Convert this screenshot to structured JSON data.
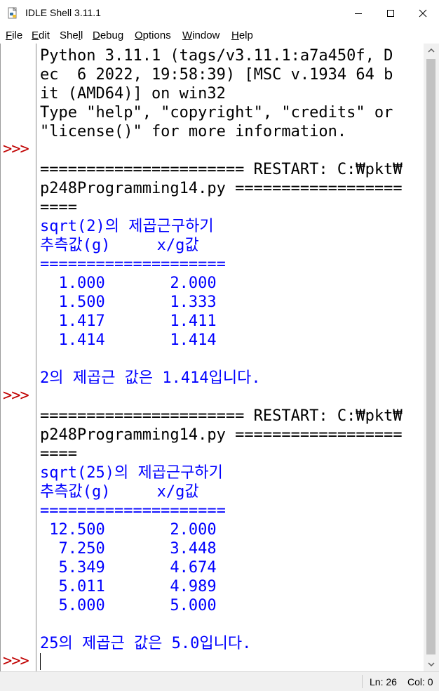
{
  "window": {
    "title": "IDLE Shell 3.11.1",
    "icon": "idle-python-icon"
  },
  "menu": {
    "items": [
      {
        "ul": "F",
        "rest": "ile"
      },
      {
        "ul": "E",
        "rest": "dit"
      },
      {
        "pre": "She",
        "ul": "l",
        "rest": "l"
      },
      {
        "ul": "D",
        "rest": "ebug"
      },
      {
        "ul": "O",
        "rest": "ptions"
      },
      {
        "ul": "W",
        "rest": "indow"
      },
      {
        "ul": "H",
        "rest": "elp"
      }
    ]
  },
  "prompt_symbol": ">>>",
  "shell": {
    "lines": [
      {
        "text": "Python 3.11.1 (tags/v3.11.1:a7a450f, D",
        "color": "black"
      },
      {
        "text": "ec  6 2022, 19:58:39) [MSC v.1934 64 b",
        "color": "black"
      },
      {
        "text": "it (AMD64)] on win32",
        "color": "black"
      },
      {
        "text": "Type \"help\", \"copyright\", \"credits\" or",
        "color": "black"
      },
      {
        "text": "\"license()\" for more information.",
        "color": "black"
      },
      {
        "text": "",
        "color": "black"
      },
      {
        "text": "====================== RESTART: C:₩pkt₩",
        "color": "black"
      },
      {
        "text": "p248Programming14.py ==================",
        "color": "black"
      },
      {
        "text": "====",
        "color": "black"
      },
      {
        "text": "sqrt(2)의 제곱근구하기",
        "color": "blue"
      },
      {
        "text": "추측값(g)     x/g값",
        "color": "blue"
      },
      {
        "text": "====================",
        "color": "blue"
      },
      {
        "text": "  1.000       2.000",
        "color": "blue"
      },
      {
        "text": "  1.500       1.333",
        "color": "blue"
      },
      {
        "text": "  1.417       1.411",
        "color": "blue"
      },
      {
        "text": "  1.414       1.414",
        "color": "blue"
      },
      {
        "text": "",
        "color": "blue"
      },
      {
        "text": "2의 제곱근 값은 1.414입니다.",
        "color": "blue"
      },
      {
        "text": "",
        "color": "black"
      },
      {
        "text": "====================== RESTART: C:₩pkt₩",
        "color": "black"
      },
      {
        "text": "p248Programming14.py ==================",
        "color": "black"
      },
      {
        "text": "====",
        "color": "black"
      },
      {
        "text": "sqrt(25)의 제곱근구하기",
        "color": "blue"
      },
      {
        "text": "추측값(g)     x/g값",
        "color": "blue"
      },
      {
        "text": "====================",
        "color": "blue"
      },
      {
        "text": " 12.500       2.000",
        "color": "blue"
      },
      {
        "text": "  7.250       3.448",
        "color": "blue"
      },
      {
        "text": "  5.349       4.674",
        "color": "blue"
      },
      {
        "text": "  5.011       4.989",
        "color": "blue"
      },
      {
        "text": "  5.000       5.000",
        "color": "blue"
      },
      {
        "text": "",
        "color": "blue"
      },
      {
        "text": "25의 제곱근 값은 5.0입니다.",
        "color": "blue"
      },
      {
        "text": "",
        "color": "black"
      }
    ]
  },
  "status": {
    "line": "Ln: 26",
    "col": "Col: 0"
  }
}
